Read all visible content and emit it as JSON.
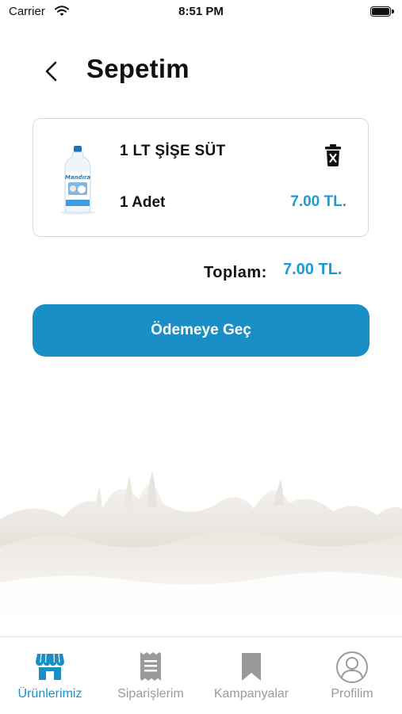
{
  "status_bar": {
    "carrier": "Carrier",
    "time": "8:51 PM"
  },
  "header": {
    "title": "Sepetim"
  },
  "cart": {
    "items": [
      {
        "name": "1 LT ŞİŞE SÜT",
        "quantity": "1 Adet",
        "price": "7.00 TL.",
        "brand_text": "Mandıra"
      }
    ],
    "total_label": "Toplam:",
    "total_value": "7.00 TL."
  },
  "checkout": {
    "label": "Ödemeye Geç"
  },
  "tab_bar": {
    "tabs": [
      {
        "label": "Ürünlerimiz",
        "icon": "store-icon",
        "active": true
      },
      {
        "label": "Siparişlerim",
        "icon": "receipt-icon",
        "active": false
      },
      {
        "label": "Kampanyalar",
        "icon": "bookmark-icon",
        "active": false
      },
      {
        "label": "Profilim",
        "icon": "profile-icon",
        "active": false
      }
    ]
  },
  "colors": {
    "accent": "#1a8fc7",
    "price": "#1a9ad6",
    "inactive_tab": "#9a9a9a"
  }
}
